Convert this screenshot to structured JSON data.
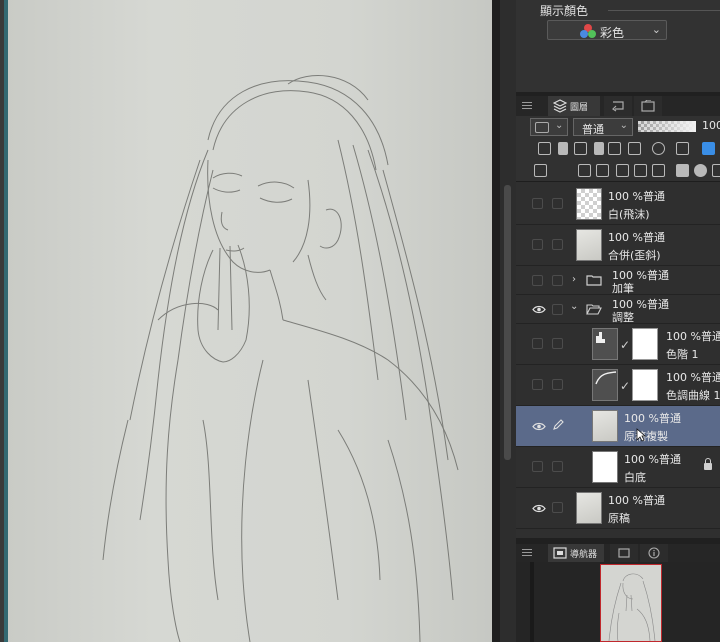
{
  "color_panel": {
    "title": "顯示顏色",
    "mode": "彩色"
  },
  "layer_panel": {
    "tab_label": "圖層",
    "blend_mode": "普通",
    "opacity_value": "100",
    "layers": [
      {
        "opacity": "100 %普通",
        "name": "白(飛沫)",
        "visible": false,
        "type": "raster"
      },
      {
        "opacity": "100 %普通",
        "name": "合併(歪斜)",
        "visible": false,
        "type": "raster"
      },
      {
        "opacity": "100 %普通",
        "name": "加筆",
        "visible": false,
        "type": "folder"
      },
      {
        "opacity": "100 %普通",
        "name": "調整",
        "visible": true,
        "type": "folder"
      },
      {
        "opacity": "100 %普通",
        "name": "色階 1",
        "visible": false,
        "type": "adjustment"
      },
      {
        "opacity": "100 %普通",
        "name": "色調曲線 1",
        "visible": false,
        "type": "adjustment"
      },
      {
        "opacity": "100 %普通",
        "name": "原稿複製",
        "visible": true,
        "type": "raster",
        "selected": true
      },
      {
        "opacity": "100 %普通",
        "name": "白底",
        "visible": false,
        "type": "raster",
        "locked": true
      },
      {
        "opacity": "100 %普通",
        "name": "原稿",
        "visible": true,
        "type": "raster"
      }
    ]
  },
  "navigator": {
    "tab_label": "導航器"
  }
}
